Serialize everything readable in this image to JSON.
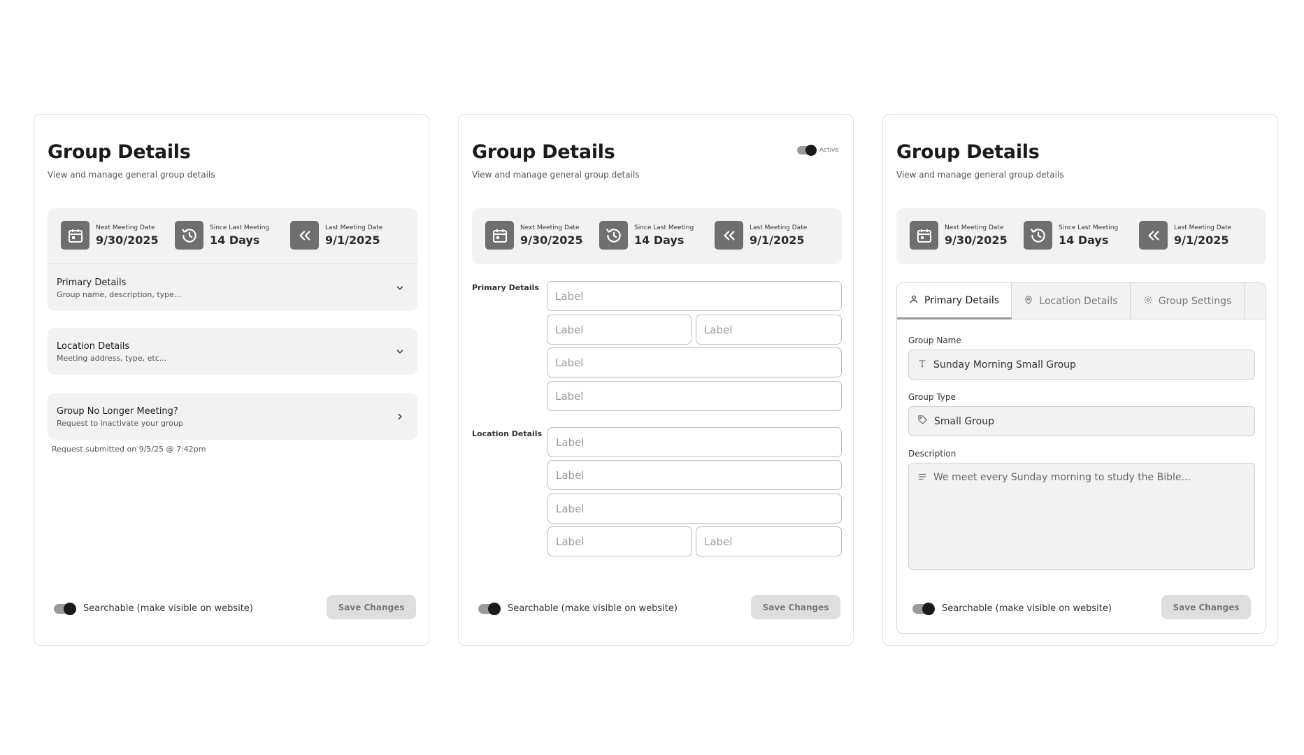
{
  "cards": [
    {
      "title": "Group Details",
      "subtitle": "View and manage general group details",
      "stats": [
        {
          "label": "Next Meeting Date",
          "value": "9/30/2025",
          "icon": "calendar-icon"
        },
        {
          "label": "Since Last Meeting",
          "value": "14 Days",
          "icon": "history-icon"
        },
        {
          "label": "Last Meeting Date",
          "value": "9/1/2025",
          "icon": "double-chevron-left-icon"
        }
      ],
      "accordions": [
        {
          "title": "Primary Details",
          "desc": "Group name, description, type..."
        },
        {
          "title": "Location Details",
          "desc": "Meeting address, type, etc..."
        },
        {
          "title": "Group No Longer Meeting?",
          "desc": "Request to inactivate your group"
        }
      ],
      "note": "Request submitted on 9/5/25 @ 7:42pm",
      "searchable_label": "Searchable (make visible on website)",
      "save_label": "Save Changes"
    },
    {
      "title": "Group Details",
      "subtitle": "View and manage general group details",
      "active_label": "Active",
      "stats": [
        {
          "label": "Next Meeting Date",
          "value": "9/30/2025",
          "icon": "calendar-icon"
        },
        {
          "label": "Since Last Meeting",
          "value": "14 Days",
          "icon": "history-icon"
        },
        {
          "label": "Last Meeting Date",
          "value": "9/1/2025",
          "icon": "double-chevron-left-icon"
        }
      ],
      "primary_label": "Primary Details",
      "location_label": "Location Details",
      "placeholder": "Label",
      "searchable_label": "Searchable (make visible on website)",
      "save_label": "Save Changes"
    },
    {
      "title": "Group Details",
      "subtitle": "View and manage general group details",
      "stats": [
        {
          "label": "Next Meeting Date",
          "value": "9/30/2025",
          "icon": "calendar-icon"
        },
        {
          "label": "Since Last Meeting",
          "value": "14 Days",
          "icon": "history-icon"
        },
        {
          "label": "Last Meeting Date",
          "value": "9/1/2025",
          "icon": "double-chevron-left-icon"
        }
      ],
      "tabs": [
        {
          "label": "Primary Details",
          "icon": "user-icon",
          "active": true
        },
        {
          "label": "Location Details",
          "icon": "map-pin-icon",
          "active": false
        },
        {
          "label": "Group Settings",
          "icon": "gear-icon",
          "active": false
        }
      ],
      "fields": {
        "group_name_label": "Group Name",
        "group_name_value": "Sunday Morning Small Group",
        "group_type_label": "Group Type",
        "group_type_value": "Small Group",
        "description_label": "Description",
        "description_value": "We meet every Sunday morning to study the Bible..."
      },
      "searchable_label": "Searchable (make visible on website)",
      "save_label": "Save Changes"
    }
  ]
}
